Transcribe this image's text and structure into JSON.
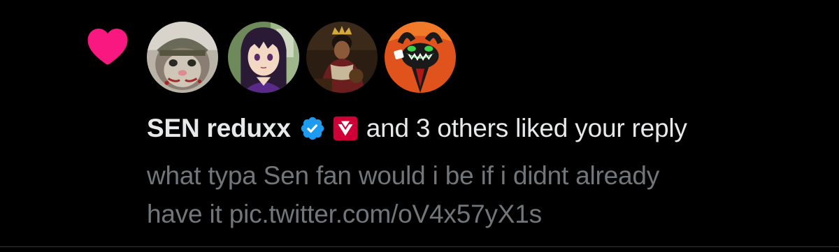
{
  "notification": {
    "type": "like",
    "icon": "heart-icon",
    "heart_color": "#f91880",
    "avatars": [
      {
        "icon": "avatar-cat-helmet"
      },
      {
        "icon": "avatar-anime-girl"
      },
      {
        "icon": "avatar-king-portrait"
      },
      {
        "icon": "avatar-cartoon-demon"
      }
    ],
    "user_name": "SEN reduxx",
    "verified_badge": "verified-icon",
    "verified_color": "#1d9bf0",
    "affiliate_badge": "sentinels-logo-icon",
    "affiliate_color": "#ce0037",
    "action_text": "and 3 others liked your reply",
    "reply_lines": [
      "what typa Sen fan would i be if i didnt already",
      "have it pic.twitter.com/oV4x57yX1s"
    ]
  }
}
